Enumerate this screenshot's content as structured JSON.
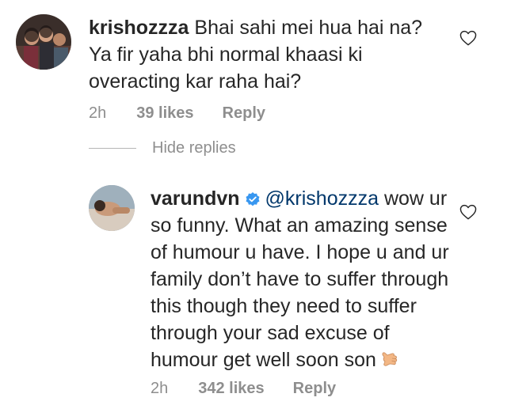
{
  "comment": {
    "username": "krishozzza",
    "text": "Bhai sahi mei hua hai na? Ya fir yaha bhi normal khaasi ki overacting kar raha hai?",
    "time": "2h",
    "likes": "39 likes",
    "reply_label": "Reply"
  },
  "hide_replies_label": "Hide replies",
  "reply": {
    "username": "varundvn",
    "mention": "@krishozzza",
    "text": "wow ur so funny. What an amazing sense of humour u have. I hope u and ur family don’t have to suffer through this though they need to suffer through your sad excuse of humour get well soon son",
    "time": "2h",
    "likes": "342 likes",
    "reply_label": "Reply"
  },
  "icons": {
    "like": "heart-outline-icon",
    "verified": "verified-badge-icon",
    "emoji": "call-me-hand-emoji"
  },
  "colors": {
    "text": "#262626",
    "meta": "#8e8e8e",
    "mention": "#00376b",
    "verified": "#3897f0"
  }
}
